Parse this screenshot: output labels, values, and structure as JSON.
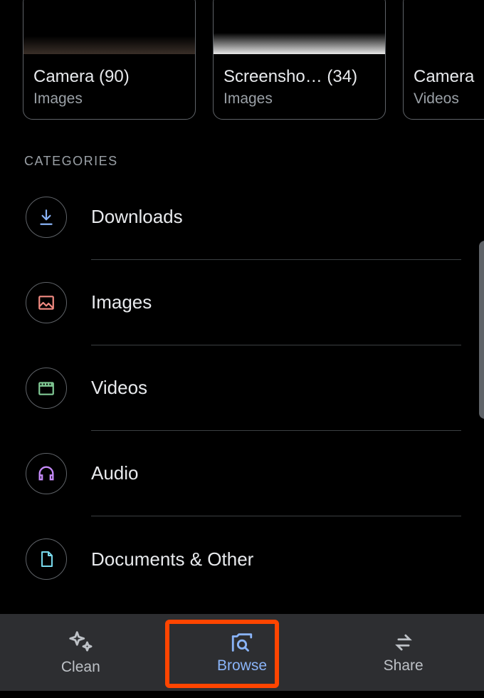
{
  "albums": [
    {
      "title": "Camera (90)",
      "subtitle": "Images"
    },
    {
      "title": "Screensho… (34)",
      "subtitle": "Images"
    },
    {
      "title": "Camera",
      "subtitle": "Videos"
    }
  ],
  "section_header": "CATEGORIES",
  "categories": [
    {
      "label": "Downloads"
    },
    {
      "label": "Images"
    },
    {
      "label": "Videos"
    },
    {
      "label": "Audio"
    },
    {
      "label": "Documents & Other"
    }
  ],
  "nav": {
    "clean": "Clean",
    "browse": "Browse",
    "share": "Share"
  }
}
